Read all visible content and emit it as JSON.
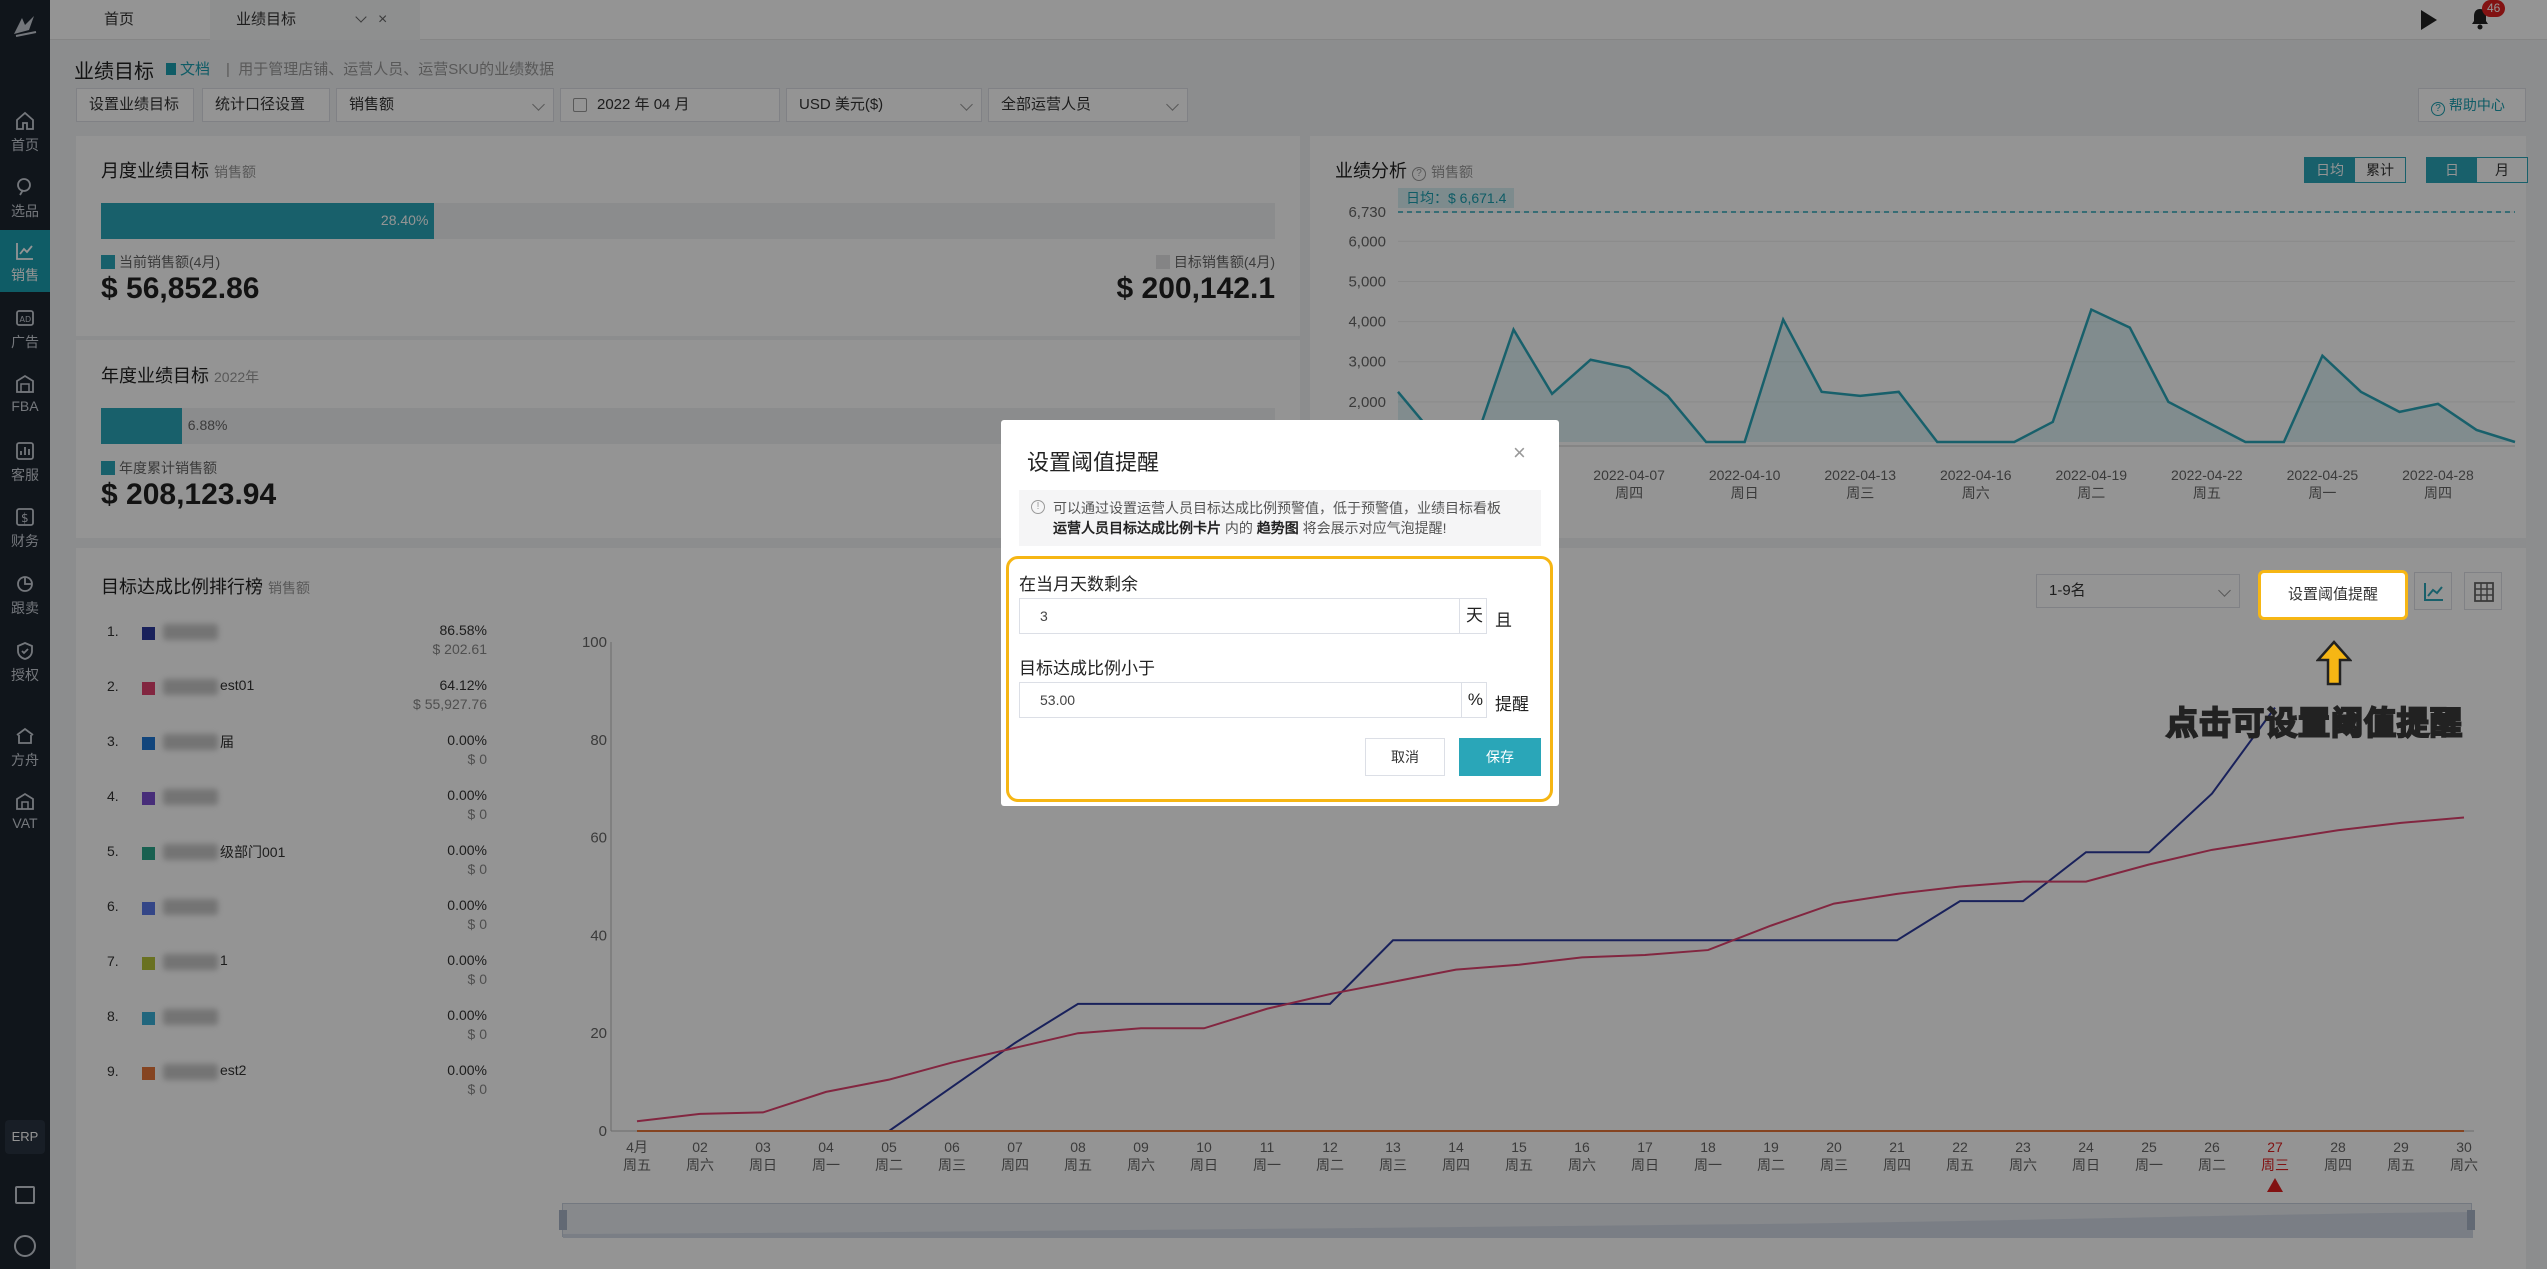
{
  "tabs": {
    "home": "首页",
    "active": "业绩目标"
  },
  "header": {
    "notif_count": "46"
  },
  "sidebar": [
    {
      "label": "首页",
      "icon": "home-icon"
    },
    {
      "label": "选品",
      "icon": "search-icon"
    },
    {
      "label": "销售",
      "icon": "chart-icon"
    },
    {
      "label": "广告",
      "icon": "ad-icon"
    },
    {
      "label": "FBA",
      "icon": "warehouse-icon"
    },
    {
      "label": "客服",
      "icon": "bar-icon"
    },
    {
      "label": "财务",
      "icon": "dollar-icon"
    },
    {
      "label": "跟卖",
      "icon": "pie-icon"
    },
    {
      "label": "授权",
      "icon": "shield-icon"
    },
    {
      "label": "方舟",
      "icon": "ark-icon"
    },
    {
      "label": "VAT",
      "icon": "building-icon"
    }
  ],
  "sidebar_erp": "ERP",
  "page": {
    "title": "业绩目标",
    "doc_link": "文档",
    "desc": "用于管理店铺、运营人员、运营SKU的业绩数据",
    "help": "帮助中心"
  },
  "toolbar": {
    "set_target": "设置业绩目标",
    "stat_setting": "统计口径设置",
    "metric": "销售额",
    "month": "2022 年 04 月",
    "currency": "USD  美元($)",
    "staff": "全部运营人员"
  },
  "monthly": {
    "title": "月度业绩目标",
    "sub": "销售额",
    "progress_pct": 28.4,
    "progress_label": "28.40%",
    "current_label": "当前销售额(4月)",
    "current_value": "$ 56,852.86",
    "target_label": "目标销售额(4月)",
    "target_value": "$ 200,142.1"
  },
  "yearly": {
    "title": "年度业绩目标",
    "sub": "2022年",
    "progress_pct": 6.88,
    "progress_label": "6.88%",
    "cum_label": "年度累计销售额",
    "cum_value": "$ 208,123.94"
  },
  "analysis": {
    "title": "业绩分析",
    "sub": "销售额",
    "btn_daily_avg": "日均",
    "btn_cum": "累计",
    "btn_day": "日",
    "btn_month": "月",
    "avg_label": "日均：$ 6,671.4"
  },
  "ranking": {
    "title": "目标达成比例排行榜",
    "sub": "销售额",
    "range_select": "1-9名",
    "set_alert_button": "设置阈值提醒",
    "items": [
      {
        "rank": "1.",
        "name_suffix": "",
        "pct": "86.58%",
        "amt": "$ 202.61",
        "color": "#2b3a9e"
      },
      {
        "rank": "2.",
        "name_suffix": "est01",
        "pct": "64.12%",
        "amt": "$ 55,927.76",
        "color": "#e0426f"
      },
      {
        "rank": "3.",
        "name_suffix": "届",
        "pct": "0.00%",
        "amt": "$ 0",
        "color": "#1e78d6"
      },
      {
        "rank": "4.",
        "name_suffix": "",
        "pct": "0.00%",
        "amt": "$ 0",
        "color": "#7a4fd0"
      },
      {
        "rank": "5.",
        "name_suffix": "级部门001",
        "pct": "0.00%",
        "amt": "$ 0",
        "color": "#2aa58a"
      },
      {
        "rank": "6.",
        "name_suffix": "",
        "pct": "0.00%",
        "amt": "$ 0",
        "color": "#5b79e8"
      },
      {
        "rank": "7.",
        "name_suffix": "1",
        "pct": "0.00%",
        "amt": "$ 0",
        "color": "#b5c33a"
      },
      {
        "rank": "8.",
        "name_suffix": "",
        "pct": "0.00%",
        "amt": "$ 0",
        "color": "#3ab0d8"
      },
      {
        "rank": "9.",
        "name_suffix": "est2",
        "pct": "0.00%",
        "amt": "$ 0",
        "color": "#e5763a"
      }
    ]
  },
  "annotation": {
    "text": "点击可设置阈值提醒"
  },
  "modal": {
    "title": "设置阈值提醒",
    "tip_line1": "可以通过设置运营人员目标达成比例预警值，低于预警值，业绩目标看板",
    "tip_bold1": "运营人员目标达成比例卡片",
    "tip_mid": " 内的 ",
    "tip_bold2": "趋势图",
    "tip_end": " 将会展示对应气泡提醒!",
    "days_label": "在当月天数剩余",
    "days_value": "3",
    "days_unit": "天",
    "days_suffix": "且",
    "ratio_label": "目标达成比例小于",
    "ratio_value": "53.00",
    "ratio_unit": "%",
    "ratio_suffix": "提醒",
    "cancel": "取消",
    "save": "保存"
  },
  "chart_data": [
    {
      "type": "area",
      "title": "业绩分析",
      "y_ticks": [
        "6,730",
        "6,000",
        "5,000",
        "4,000",
        "3,000",
        "2,000"
      ],
      "x_ticks": [
        {
          "date": "2022-04-07",
          "dow": "周四"
        },
        {
          "date": "2022-04-10",
          "dow": "周日"
        },
        {
          "date": "2022-04-13",
          "dow": "周三"
        },
        {
          "date": "2022-04-16",
          "dow": "周六"
        },
        {
          "date": "2022-04-19",
          "dow": "周二"
        },
        {
          "date": "2022-04-22",
          "dow": "周五"
        },
        {
          "date": "2022-04-25",
          "dow": "周一"
        },
        {
          "date": "2022-04-28",
          "dow": "周四"
        }
      ],
      "avg_line": 6730,
      "ylim": [
        1000,
        6730
      ],
      "values": [
        2250,
        1100,
        1000,
        3800,
        2200,
        3050,
        2850,
        2150,
        1000,
        400,
        4050,
        2250,
        2150,
        2250,
        550,
        900,
        200,
        1500,
        4300,
        3850,
        2000,
        1500,
        800,
        100,
        3150,
        2250,
        1750,
        1950,
        1300,
        1000
      ],
      "color": "#2aa6b8"
    },
    {
      "type": "line",
      "title": "目标达成比例排行榜",
      "y_ticks": [
        0,
        20,
        40,
        60,
        80,
        100
      ],
      "ylim": [
        0,
        100
      ],
      "x_ticks": [
        {
          "d": "4月",
          "w": "周五"
        },
        {
          "d": "02",
          "w": "周六"
        },
        {
          "d": "03",
          "w": "周日"
        },
        {
          "d": "04",
          "w": "周一"
        },
        {
          "d": "05",
          "w": "周二"
        },
        {
          "d": "06",
          "w": "周三"
        },
        {
          "d": "07",
          "w": "周四"
        },
        {
          "d": "08",
          "w": "周五"
        },
        {
          "d": "09",
          "w": "周六"
        },
        {
          "d": "10",
          "w": "周日"
        },
        {
          "d": "11",
          "w": "周一"
        },
        {
          "d": "12",
          "w": "周二"
        },
        {
          "d": "13",
          "w": "周三"
        },
        {
          "d": "14",
          "w": "周四"
        },
        {
          "d": "15",
          "w": "周五"
        },
        {
          "d": "16",
          "w": "周六"
        },
        {
          "d": "17",
          "w": "周日"
        },
        {
          "d": "18",
          "w": "周一"
        },
        {
          "d": "19",
          "w": "周二"
        },
        {
          "d": "20",
          "w": "周三"
        },
        {
          "d": "21",
          "w": "周四"
        },
        {
          "d": "22",
          "w": "周五"
        },
        {
          "d": "23",
          "w": "周六"
        },
        {
          "d": "24",
          "w": "周日"
        },
        {
          "d": "25",
          "w": "周一"
        },
        {
          "d": "26",
          "w": "周二"
        },
        {
          "d": "27",
          "w": "周三"
        },
        {
          "d": "28",
          "w": "周四"
        },
        {
          "d": "29",
          "w": "周五"
        },
        {
          "d": "30",
          "w": "周六"
        }
      ],
      "alert_index": 26,
      "series": [
        {
          "color": "#2b3a9e",
          "values": [
            0,
            0,
            0,
            0,
            0,
            9,
            18,
            26,
            26,
            26,
            26,
            26,
            39,
            39,
            39,
            39,
            39,
            39,
            39,
            39,
            39,
            47,
            47,
            57,
            57,
            69,
            86.58,
            null,
            null,
            null
          ]
        },
        {
          "color": "#e0426f",
          "values": [
            2,
            3.5,
            3.8,
            8,
            10.5,
            14,
            17,
            20,
            21,
            21,
            25,
            28,
            30.5,
            33,
            34,
            35.5,
            36,
            37,
            42,
            46.5,
            48.5,
            50,
            51,
            51,
            54.5,
            57.5,
            59.5,
            61.5,
            63,
            64.12
          ]
        },
        {
          "color": "#e5763a",
          "values": [
            0,
            0,
            0,
            0,
            0,
            0,
            0,
            0,
            0,
            0,
            0,
            0,
            0,
            0,
            0,
            0,
            0,
            0,
            0,
            0,
            0,
            0,
            0,
            0,
            0,
            0,
            0,
            0,
            0,
            0
          ]
        }
      ]
    }
  ]
}
